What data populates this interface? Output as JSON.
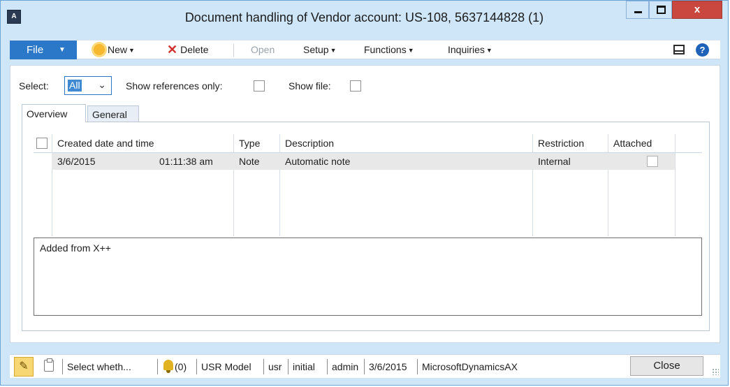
{
  "window": {
    "title": "Document handling of Vendor account: US-108, 5637144828 (1)",
    "close_glyph": "x"
  },
  "toolbar": {
    "file_label": "File",
    "new_label": "New",
    "delete_label": "Delete",
    "open_label": "Open",
    "setup_label": "Setup",
    "functions_label": "Functions",
    "inquiries_label": "Inquiries"
  },
  "filters": {
    "select_label": "Select:",
    "select_value": "All",
    "show_refs_label": "Show references only:",
    "show_file_label": "Show file:"
  },
  "tabs": [
    {
      "label": "Overview",
      "active": true
    },
    {
      "label": "General",
      "active": false
    }
  ],
  "grid": {
    "columns": [
      "Created date and time",
      "Type",
      "Description",
      "Restriction",
      "Attached"
    ],
    "rows": [
      {
        "date": "3/6/2015",
        "time": "01:11:38 am",
        "type": "Note",
        "description": "Automatic note",
        "restriction": "Internal",
        "attached": false
      }
    ]
  },
  "notes": {
    "text": "Added from X++"
  },
  "statusbar": {
    "help_text": "Select wheth...",
    "notifications": "(0)",
    "layer": "USR Model",
    "user": "usr",
    "model": "initial",
    "company": "admin",
    "date": "3/6/2015",
    "app": "MicrosoftDynamicsAX",
    "close_label": "Close"
  },
  "colors": {
    "accent": "#2b78c8",
    "window_bg": "#cfe6f8",
    "close_red": "#c9473f"
  },
  "icons": [
    "app-icon",
    "minimize-icon",
    "maximize-icon",
    "close-icon",
    "new-icon",
    "delete-icon",
    "layout-icon",
    "help-icon",
    "edit-pencil-icon",
    "attachment-icon",
    "bell-icon",
    "resize-grip-icon"
  ]
}
